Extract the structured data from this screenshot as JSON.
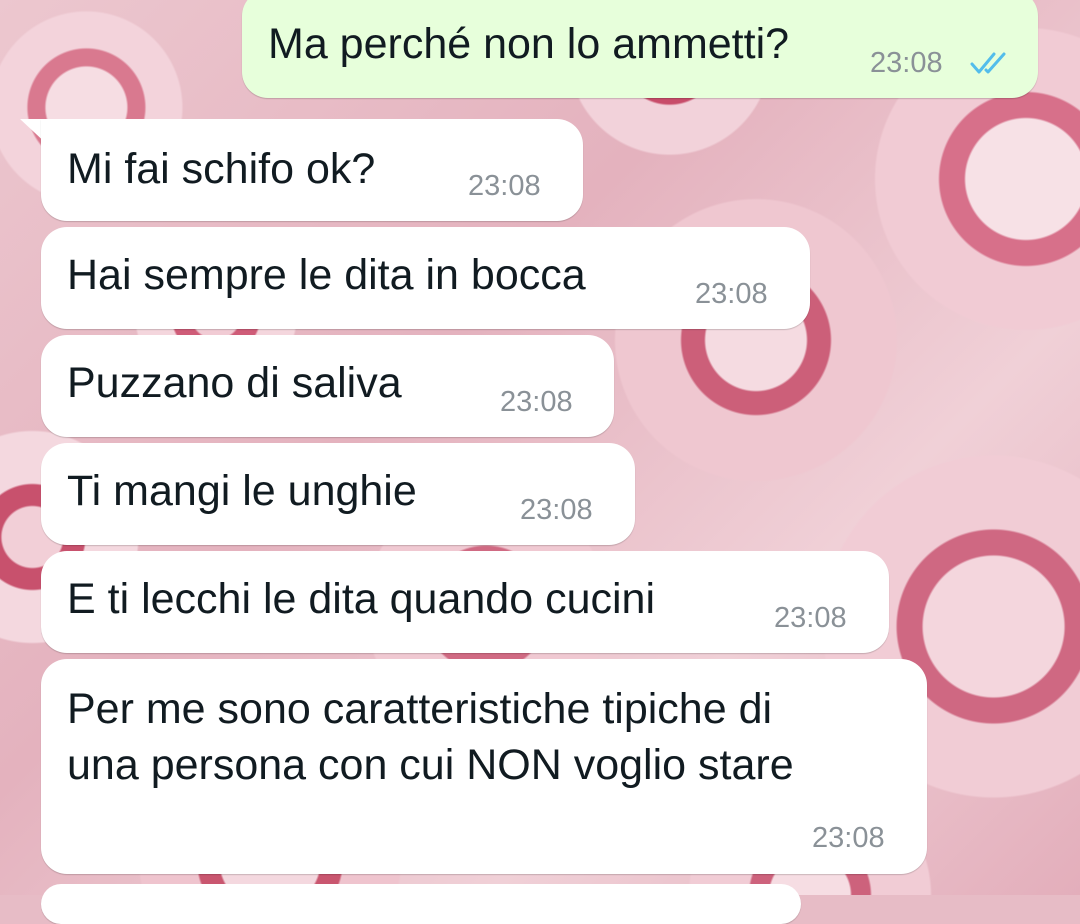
{
  "chat": {
    "messages": [
      {
        "id": "m1",
        "direction": "outgoing",
        "text": "Ma perché non lo ammetti?",
        "time": "23:08",
        "status_icon": "double-check-read-icon"
      },
      {
        "id": "m2",
        "direction": "incoming",
        "text": "Mi fai schifo ok?",
        "time": "23:08"
      },
      {
        "id": "m3",
        "direction": "incoming",
        "text": "Hai sempre le dita in bocca",
        "time": "23:08"
      },
      {
        "id": "m4",
        "direction": "incoming",
        "text": "Puzzano di saliva",
        "time": "23:08"
      },
      {
        "id": "m5",
        "direction": "incoming",
        "text": "Ti mangi le unghie",
        "time": "23:08"
      },
      {
        "id": "m6",
        "direction": "incoming",
        "text": "E ti lecchi le dita quando cucini",
        "time": "23:08"
      },
      {
        "id": "m7",
        "direction": "incoming",
        "text_line1": "Per me sono caratteristiche tipiche di",
        "text_line2": "una persona con cui NON voglio stare",
        "time": "23:08"
      }
    ]
  },
  "colors": {
    "outgoing_bubble": "#e7ffdb",
    "incoming_bubble": "#ffffff",
    "timestamp": "#8a9197",
    "read_ticks": "#53bdeb"
  }
}
